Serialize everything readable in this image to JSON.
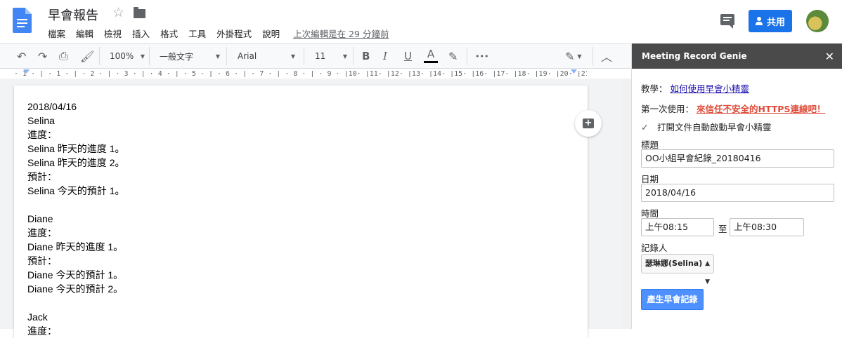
{
  "header": {
    "title": "早會報告",
    "menu": [
      "檔案",
      "編輯",
      "檢視",
      "插入",
      "格式",
      "工具",
      "外掛程式",
      "說明"
    ],
    "last_edit": "上次編輯是在 29 分鐘前",
    "share_label": "共用"
  },
  "toolbar": {
    "zoom": "100%",
    "style": "一般文字",
    "font": "Arial",
    "size": "11",
    "bold": "B",
    "italic": "I",
    "underline": "U",
    "text_color": "A",
    "more": "•••"
  },
  "ruler": {
    "text": "· 1 · | · 1 · | · 2 · | · 3 · | · 4 · | · 5 · | · 6 · | · 7 · | · 8 · | · 9 · |10· |11· |12· |13· |14· |15· |16· |17· |18· |19· |20· |21"
  },
  "document": {
    "lines": [
      "2018/04/16",
      "Selina",
      "進度：",
      "Selina 昨天的進度 1。",
      "Selina 昨天的進度 2。",
      "預計：",
      "Selina 今天的預計 1。",
      "",
      "Diane",
      "進度：",
      "Diane 昨天的進度 1。",
      "預計：",
      "Diane 今天的預計 1。",
      "Diane 今天的預計 2。",
      "",
      "Jack",
      "進度："
    ]
  },
  "sidebar": {
    "title": "Meeting Record Genie",
    "close": "✕",
    "tutorial_label": "教學：",
    "tutorial_link": "如何使用早會小精靈",
    "first_use_label": "第一次使用：",
    "first_use_link": "來信任不安全的HTTPS連線吧！",
    "auto_start_label": "打開文件自動啟動早會小精靈",
    "title_label": "標題",
    "title_value": "OO小組早會紀錄_20180416",
    "date_label": "日期",
    "date_value": "2018/04/16",
    "time_label": "時間",
    "time_start": "上午08:15",
    "time_to": "至",
    "time_end": "上午08:30",
    "recorder_label": "記錄人",
    "recorder_value": "瑟琳娜(Selina)",
    "generate_button": "產生早會記錄"
  },
  "colors": {
    "accent": "#1a73e8",
    "sidebar_header": "#4a4a4a",
    "generate_button": "#4d90fe",
    "warning_link": "#dd4b39"
  }
}
